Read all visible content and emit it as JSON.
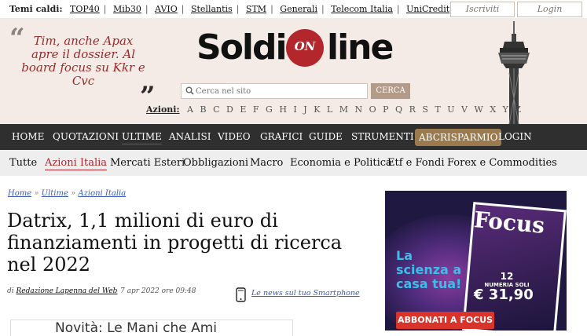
{
  "topbar": {
    "hot_label": "Temi caldi:",
    "hot_topics": [
      "TOP40",
      "Mib30",
      "AVIO",
      "Stellantis",
      "STM",
      "Generali",
      "Telecom Italia",
      "UniCredit"
    ],
    "register_label": "Iscriviti",
    "login_label": "Login"
  },
  "header": {
    "teaser": "Tim, anche Apax apre il dossier. Al board focus su Kkr e Cvc",
    "logo_left": "Soldi",
    "logo_middle": "ON",
    "logo_right": "line",
    "search_placeholder": "Cerca nel sito",
    "search_button": "CERCA",
    "azioni_label": "Azioni:",
    "letters": [
      "A",
      "B",
      "C",
      "D",
      "E",
      "F",
      "G",
      "H",
      "I",
      "J",
      "K",
      "L",
      "M",
      "N",
      "O",
      "P",
      "Q",
      "R",
      "S",
      "T",
      "U",
      "V",
      "W",
      "X",
      "Y",
      "Z"
    ]
  },
  "nav": {
    "items": [
      "HOME",
      "QUOTAZIONI",
      "ULTIME",
      "ANALISI",
      "VIDEO",
      "GRAFICI",
      "GUIDE",
      "STRUMENTI",
      "ABCRISPARMIO",
      "LOGIN"
    ],
    "active": "ULTIME",
    "highlight": "ABCRISPARMIO"
  },
  "subnav": {
    "items": [
      "Tutte",
      "Azioni Italia",
      "Mercati Esteri",
      "Obbligazioni",
      "Macro",
      "Economia e Politica",
      "Etf e Fondi",
      "Forex e Commodities"
    ],
    "active": "Azioni Italia"
  },
  "article": {
    "breadcrumb": [
      "Home",
      "Ultime",
      "Azioni Italia"
    ],
    "title": "Datrix, 1,1 milioni di euro di finanziamenti in progetti di ricerca nel 2022",
    "author_prefix": "di",
    "author": "Redazione Lapenna del Web",
    "date": "7 apr 2022 ore 09:48",
    "mobile_link": "Le news sul tuo Smartphone",
    "promo_text": "Novità: Le Mani che Ami"
  },
  "ad": {
    "magazine": "Focus",
    "slogan": "La scienza a casa tua!",
    "issues_count": "12",
    "issues_label": "NUMERIA SOLI",
    "price": "€ 31,90",
    "cta": "ABBONATI A FOCUS"
  },
  "colors": {
    "header_bg": "#f5ebe6",
    "nav_bg": "#2f2f2f",
    "accent_red": "#b3262b",
    "highlight_gold": "#9b7b4d",
    "link_blue": "#3a5bb8"
  }
}
